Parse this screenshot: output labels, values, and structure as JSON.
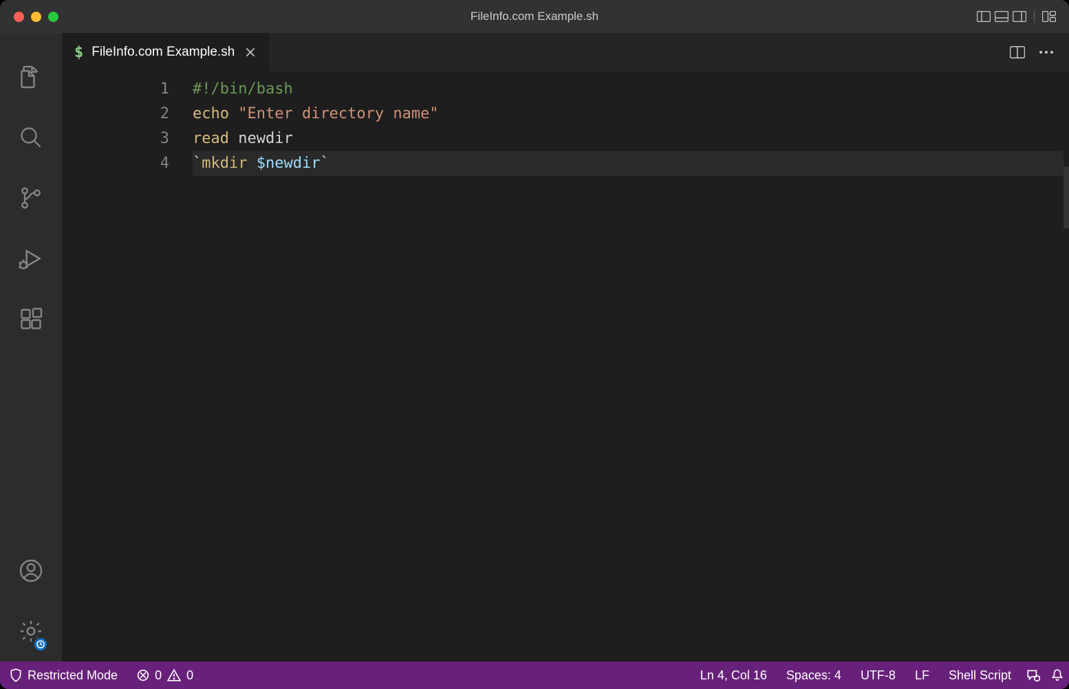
{
  "window": {
    "title": "FileInfo.com Example.sh"
  },
  "tabs": [
    {
      "icon": "$",
      "label": "FileInfo.com Example.sh"
    }
  ],
  "editor": {
    "lines": [
      {
        "num": "1",
        "tokens": [
          {
            "cls": "tok-comment",
            "text": "#!/bin/bash"
          }
        ]
      },
      {
        "num": "2",
        "tokens": [
          {
            "cls": "tok-cmd",
            "text": "echo"
          },
          {
            "cls": "tok-plain",
            "text": " "
          },
          {
            "cls": "tok-str",
            "text": "\"Enter directory name\""
          }
        ]
      },
      {
        "num": "3",
        "tokens": [
          {
            "cls": "tok-cmd",
            "text": "read"
          },
          {
            "cls": "tok-plain",
            "text": " newdir"
          }
        ]
      },
      {
        "num": "4",
        "current": true,
        "tokens": [
          {
            "cls": "tok-punc",
            "text": "`"
          },
          {
            "cls": "tok-cmd",
            "text": "mkdir"
          },
          {
            "cls": "tok-plain",
            "text": " "
          },
          {
            "cls": "tok-var",
            "text": "$newdir"
          },
          {
            "cls": "tok-punc",
            "text": "`"
          }
        ]
      }
    ]
  },
  "status": {
    "restricted": "Restricted Mode",
    "errors": "0",
    "warnings": "0",
    "cursor": "Ln 4, Col 16",
    "indent": "Spaces: 4",
    "encoding": "UTF-8",
    "eol": "LF",
    "language": "Shell Script"
  }
}
